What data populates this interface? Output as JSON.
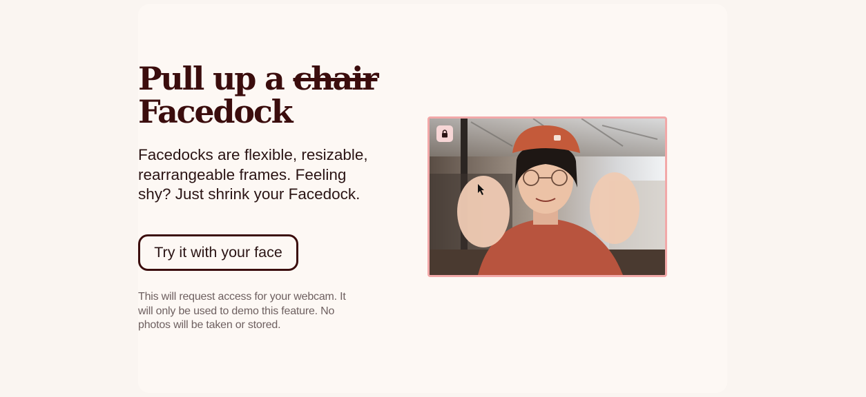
{
  "headline": {
    "prefix": "Pull up a ",
    "struck_word": "chair",
    "line2": "Facedock"
  },
  "description": "Facedocks are flexible, resizable, rearrangeable frames. Feeling shy? Just shrink your Facedock.",
  "cta_label": "Try it with your face",
  "disclaimer": "This will request access for your webcam. It will only be used to demo this feature. No photos will be taken or stored.",
  "facedock": {
    "lock_icon": "lock-icon",
    "border_color": "#f2a8a8"
  },
  "colors": {
    "heading": "#3b0d0d",
    "background": "#fdf8f4"
  }
}
